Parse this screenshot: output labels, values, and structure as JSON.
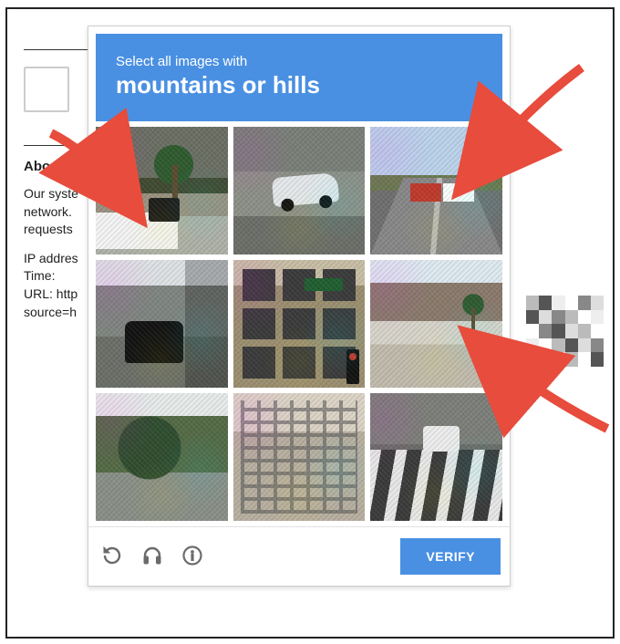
{
  "background": {
    "heading": "About th",
    "para_line1": "Our syste",
    "para_line2": "network.",
    "para_line3": "requests",
    "meta": {
      "ip": "IP addres",
      "time": "Time:",
      "url": "URL: http",
      "source": "source=h"
    }
  },
  "captcha": {
    "header": {
      "instruction": "Select all images with",
      "subject": "mountains or hills"
    },
    "footer": {
      "verify_label": "VERIFY"
    },
    "tiles": [
      {
        "name": "tile-1-palm-truck"
      },
      {
        "name": "tile-2-car-street"
      },
      {
        "name": "tile-3-highway-hills"
      },
      {
        "name": "tile-4-black-car-lot"
      },
      {
        "name": "tile-5-brick-building"
      },
      {
        "name": "tile-6-mountains-palm"
      },
      {
        "name": "tile-7-trees-road"
      },
      {
        "name": "tile-8-fire-escape"
      },
      {
        "name": "tile-9-crosswalk-car"
      }
    ],
    "icons": {
      "refresh": "refresh-icon",
      "audio": "headphones-icon",
      "info": "info-icon"
    }
  },
  "arrows": [
    {
      "name": "arrow-to-tile-1"
    },
    {
      "name": "arrow-to-tile-3"
    },
    {
      "name": "arrow-to-tile-6"
    }
  ]
}
